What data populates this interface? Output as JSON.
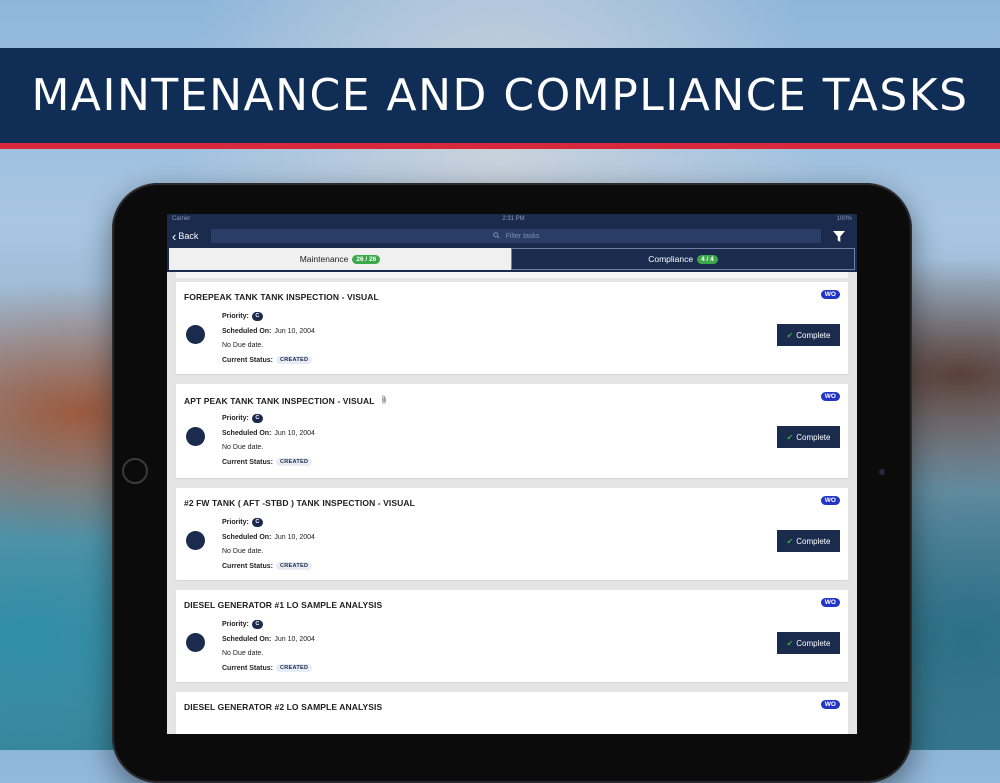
{
  "banner": {
    "title": "MAINTENANCE AND COMPLIANCE TASKS"
  },
  "status_bar": {
    "carrier": "Carrier",
    "time": "2:31 PM",
    "battery": "100%"
  },
  "nav": {
    "back_label": "Back",
    "search_placeholder": "Filter tasks"
  },
  "tabs": [
    {
      "label": "Maintenance",
      "count": "26 / 26",
      "active": true
    },
    {
      "label": "Compliance",
      "count": "4 / 4",
      "active": false
    }
  ],
  "labels": {
    "priority": "Priority:",
    "scheduled_on": "Scheduled On:",
    "current_status": "Current Status:",
    "complete_button": "Complete"
  },
  "tasks": [
    {
      "title": "FOREPEAK TANK TANK INSPECTION - VISUAL",
      "type": "WO",
      "priority": "C",
      "scheduled": "Jun 10, 2004",
      "due": "No Due date.",
      "status": "CREATED",
      "attachment": false
    },
    {
      "title": "APT PEAK TANK TANK INSPECTION - VISUAL",
      "type": "WO",
      "priority": "C",
      "scheduled": "Jun 10, 2004",
      "due": "No Due date.",
      "status": "CREATED",
      "attachment": true
    },
    {
      "title": "#2 FW TANK ( AFT -STBD ) TANK INSPECTION - VISUAL",
      "type": "WO",
      "priority": "C",
      "scheduled": "Jun 10, 2004",
      "due": "No Due date.",
      "status": "CREATED",
      "attachment": false
    },
    {
      "title": "DIESEL GENERATOR #1 LO SAMPLE ANALYSIS",
      "type": "WO",
      "priority": "C",
      "scheduled": "Jun 10, 2004",
      "due": "No Due date.",
      "status": "CREATED",
      "attachment": false
    },
    {
      "title": "DIESEL GENERATOR #2 LO SAMPLE ANALYSIS",
      "type": "WO",
      "priority": "",
      "scheduled": "",
      "due": "",
      "status": "",
      "attachment": false
    }
  ],
  "colors": {
    "navy": "#1a2b4e",
    "banner": "#0f2d55",
    "accent_red": "#d8283b",
    "badge_green": "#3ca84a",
    "wo_blue": "#2235c9"
  }
}
